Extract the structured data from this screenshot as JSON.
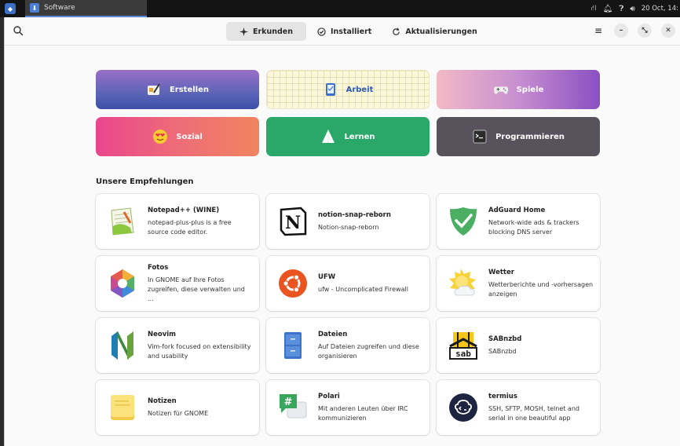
{
  "panel": {
    "task_title": "Software",
    "clock": "20 Oct, 14:"
  },
  "header": {
    "tabs": [
      {
        "label": "Erkunden"
      },
      {
        "label": "Installiert"
      },
      {
        "label": "Aktualisierungen"
      }
    ]
  },
  "categories": [
    {
      "label": "Erstellen"
    },
    {
      "label": "Arbeit"
    },
    {
      "label": "Spiele"
    },
    {
      "label": "Sozial"
    },
    {
      "label": "Lernen"
    },
    {
      "label": "Programmieren"
    }
  ],
  "recommendations": {
    "title": "Unsere Empfehlungen",
    "apps": [
      {
        "name": "Notepad++ (WINE)",
        "desc": "notepad-plus-plus is a free source code editor.",
        "icon": "notepad-icon"
      },
      {
        "name": "notion-snap-reborn",
        "desc": "Notion-snap-reborn",
        "icon": "notion-icon"
      },
      {
        "name": "AdGuard Home",
        "desc": "Network-wide ads & trackers blocking DNS server",
        "icon": "adguard-shield-icon"
      },
      {
        "name": "Fotos",
        "desc": "In GNOME auf Ihre Fotos zugreifen, diese verwalten und ...",
        "icon": "photos-icon"
      },
      {
        "name": "UFW",
        "desc": "ufw - Uncomplicated Firewall",
        "icon": "ubuntu-logo-icon"
      },
      {
        "name": "Wetter",
        "desc": "Wetterberichte und -vorhersagen anzeigen",
        "icon": "weather-sun-cloud-icon"
      },
      {
        "name": "Neovim",
        "desc": "Vim-fork focused on extensibility and usability",
        "icon": "neovim-icon"
      },
      {
        "name": "Dateien",
        "desc": "Auf Dateien zugreifen und diese organisieren",
        "icon": "file-cabinet-icon"
      },
      {
        "name": "SABnzbd",
        "desc": "SABnzbd",
        "icon": "sabnzbd-icon"
      },
      {
        "name": "Notizen",
        "desc": "Notizen für GNOME",
        "icon": "sticky-notes-icon"
      },
      {
        "name": "Polari",
        "desc": "Mit anderen Leuten über IRC kommunizieren",
        "icon": "chat-hash-icon"
      },
      {
        "name": "termius",
        "desc": "SSH, SFTP, MOSH, telnet and serial in one beautiful app",
        "icon": "termius-icon"
      }
    ]
  }
}
